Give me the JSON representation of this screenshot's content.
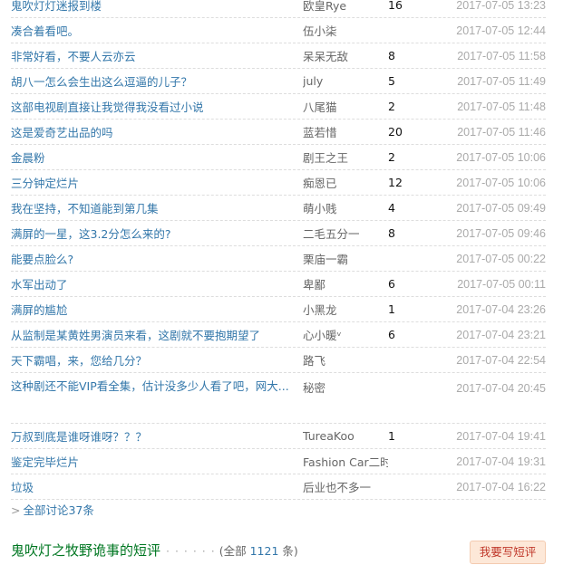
{
  "discussions": [
    {
      "title": "鬼吹灯灯迷报到楼",
      "author": "欧皇Rye",
      "count": "16",
      "time": "2017-07-05 13:23"
    },
    {
      "title": "凑合着看吧。",
      "author": "伍小柒",
      "count": "",
      "time": "2017-07-05 12:44"
    },
    {
      "title": "非常好看，不要人云亦云",
      "author": "呆呆无敌",
      "count": "8",
      "time": "2017-07-05 11:58"
    },
    {
      "title": "胡八一怎么会生出这么逗逼的儿子？",
      "author": "july",
      "count": "5",
      "time": "2017-07-05 11:49"
    },
    {
      "title": "这部电视剧直接让我觉得我没看过小说",
      "author": "八尾猫",
      "count": "2",
      "time": "2017-07-05 11:48"
    },
    {
      "title": "这是爱奇艺出品的吗",
      "author": "蓝若惜",
      "count": "20",
      "time": "2017-07-05 11:46"
    },
    {
      "title": "金晨粉",
      "author": "剧王之王",
      "count": "2",
      "time": "2017-07-05 10:06"
    },
    {
      "title": "三分钟定烂片",
      "author": "痴恩已",
      "count": "12",
      "time": "2017-07-05 10:06"
    },
    {
      "title": "我在坚持，不知道能到第几集",
      "author": "萌小贱",
      "count": "4",
      "time": "2017-07-05 09:49"
    },
    {
      "title": "满屏的一星，这3.2分怎么来的?",
      "author": "二毛五分一",
      "count": "8",
      "time": "2017-07-05 09:46"
    },
    {
      "title": "能要点脸么?",
      "author": "栗庙一霸",
      "count": "",
      "time": "2017-07-05 00:22"
    },
    {
      "title": "水军出动了",
      "author": "卑鄙",
      "count": "6",
      "time": "2017-07-05 00:11"
    },
    {
      "title": "满屏的尴尬",
      "author": "小黑龙",
      "count": "1",
      "time": "2017-07-04 23:26"
    },
    {
      "title": "从监制是某黄姓男演员来看，这剧就不要抱期望了",
      "author": "心小暖ᵛ",
      "count": "6",
      "time": "2017-07-04 23:21"
    },
    {
      "title": "天下霸唱，来，您给几分？",
      "author": "路飞",
      "count": "",
      "time": "2017-07-04 22:54"
    },
    {
      "title": "这种剧还不能VIP看全集，估计没多少人看了吧，网大...",
      "author": "秘密",
      "count": "",
      "time": "2017-07-04 20:45"
    },
    {
      "title": "万叔到底是谁呀谁呀？？？",
      "author": "TureaKoo",
      "count": "1",
      "time": "2017-07-04 19:41"
    },
    {
      "title": "鉴定完毕烂片",
      "author": "Fashion Car二时",
      "count": "",
      "time": "2017-07-04 19:31"
    },
    {
      "title": "垃圾",
      "author": "后业也不多一",
      "count": "",
      "time": "2017-07-04 16:22"
    }
  ],
  "all_discussions": {
    "arrow": ">",
    "label": "全部讨论37条"
  },
  "reviews": {
    "title": "鬼吹灯之牧野诡事的短评",
    "dots": "· · · · · ·",
    "total_prefix": "(全部 ",
    "total_count": "1121",
    "total_suffix": " 条)",
    "write_button": "我要写短评"
  }
}
